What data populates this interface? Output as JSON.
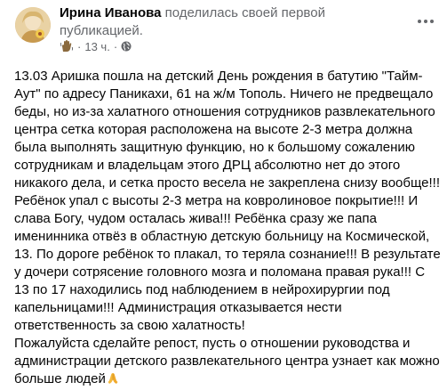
{
  "header": {
    "author_name": "Ирина Иванова",
    "action_text": "поделилась своей первой публикацией.",
    "timestamp": "13 ч.",
    "separator": "·",
    "icons": {
      "avatar": "avatar",
      "badge": "waving-hand-icon",
      "audience": "globe-icon",
      "more": "more-options-icon"
    }
  },
  "post": {
    "paragraphs": [
      "13.03 Аришка пошла на детский День рождения в батутию \"Тайм-Аут\" по адресу Паникахи, 61 на ж/м Тополь. Ничего не предвещало беды, но из-за халатного отношения сотрудников развлекательного центра сетка которая расположена на высоте 2-3 метра должна была выполнять защитную функцию, но к большому сожалению сотрудникам и владельцам этого ДРЦ абсолютно нет до этого никакого дела, и сетка просто весела не закреплена снизу вообще!!! Ребёнок упал с высоты 2-3 метра на ковролиновое покрытие!!! И слава Богу, чудом осталась жива!!! Ребёнка сразу же папа именинника отвёз в областную детскую больницу на Космической, 13. По дороге ребёнок то плакал, то теряла сознание!!! В результате у дочери сотрясение головного мозга и поломана правая рука!!! С 13 по 17 находились под наблюдением в нейрохирургии под капельницами!!! Администрация отказывается нести ответственность за свою халатность!",
      "Пожалуйста сделайте репост, пусть о  отношении руководства и администрации детского развлекательного центра узнает как можно больше людей"
    ],
    "trailing_emoji": "pray-icon"
  },
  "colors": {
    "primary_text": "#050505",
    "secondary_text": "#65676b",
    "background": "#ffffff"
  }
}
